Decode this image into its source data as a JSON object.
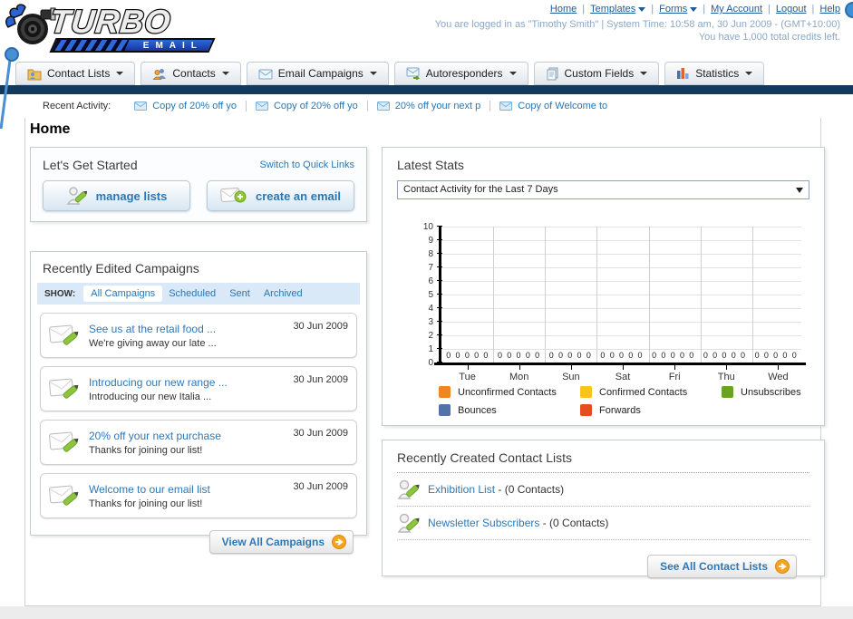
{
  "header": {
    "logo": {
      "title": "TURBO",
      "subtitle": "EMAIL"
    },
    "nav_links": [
      {
        "label": "Home",
        "has_dropdown": false
      },
      {
        "label": "Templates",
        "has_dropdown": true
      },
      {
        "label": "Forms",
        "has_dropdown": true
      },
      {
        "label": "My Account",
        "has_dropdown": false
      },
      {
        "label": "Logout",
        "has_dropdown": false
      },
      {
        "label": "Help",
        "has_dropdown": false
      }
    ],
    "login_info": "You are logged in as \"Timothy Smith\" | System Time: 10:58 am, 30 Jun 2009 - (GMT+10:00)",
    "credits_info": "You have 1,000 total credits left."
  },
  "nav_tabs": [
    {
      "label": "Contact Lists",
      "icon": "folder-contacts-icon"
    },
    {
      "label": "Contacts",
      "icon": "people-icon"
    },
    {
      "label": "Email Campaigns",
      "icon": "envelope-icon"
    },
    {
      "label": "Autoresponders",
      "icon": "envelope-arrow-icon"
    },
    {
      "label": "Custom Fields",
      "icon": "pages-icon"
    },
    {
      "label": "Statistics",
      "icon": "bar-chart-icon"
    }
  ],
  "recent_activity": {
    "label": "Recent Activity:",
    "items": [
      "Copy of 20% off yo",
      "Copy of 20% off yo",
      "20% off your next p",
      "Copy of Welcome to"
    ]
  },
  "page": {
    "title": "Home"
  },
  "get_started": {
    "title": "Let's Get Started",
    "switch_link": "Switch to Quick Links",
    "buttons": [
      {
        "label": "manage lists",
        "icon": "person-pencil-icon"
      },
      {
        "label": "create an email",
        "icon": "envelope-plus-icon"
      }
    ]
  },
  "campaigns": {
    "title": "Recently Edited Campaigns",
    "show_label": "SHOW:",
    "filters": [
      "All Campaigns",
      "Scheduled",
      "Sent",
      "Archived"
    ],
    "active_filter": "All Campaigns",
    "items": [
      {
        "title": "See us at the retail food ...",
        "subtitle": "We're giving away our late ...",
        "date": "30 Jun 2009"
      },
      {
        "title": "Introducing our new range ...",
        "subtitle": "Introducing our new Italia ...",
        "date": "30 Jun 2009"
      },
      {
        "title": "20% off your next purchase",
        "subtitle": "Thanks for joining our list!",
        "date": "30 Jun 2009"
      },
      {
        "title": "Welcome to our email list",
        "subtitle": "Thanks for joining our list!",
        "date": "30 Jun 2009"
      }
    ],
    "view_all_label": "View All Campaigns"
  },
  "stats": {
    "title": "Latest Stats",
    "dropdown_value": "Contact Activity for the Last 7 Days"
  },
  "chart_data": {
    "type": "bar",
    "title": "Contact Activity for the Last 7 Days",
    "categories": [
      "Tue",
      "Mon",
      "Sun",
      "Sat",
      "Fri",
      "Thu",
      "Wed"
    ],
    "series": [
      {
        "name": "Unconfirmed Contacts",
        "color": "#f08522",
        "values": [
          0,
          0,
          0,
          0,
          0,
          0,
          0
        ]
      },
      {
        "name": "Confirmed Contacts",
        "color": "#fbc31b",
        "values": [
          0,
          0,
          0,
          0,
          0,
          0,
          0
        ]
      },
      {
        "name": "Unsubscribes",
        "color": "#69a420",
        "values": [
          0,
          0,
          0,
          0,
          0,
          0,
          0
        ]
      },
      {
        "name": "Bounces",
        "color": "#5273a7",
        "values": [
          0,
          0,
          0,
          0,
          0,
          0,
          0
        ]
      },
      {
        "name": "Forwards",
        "color": "#e54d21",
        "values": [
          0,
          0,
          0,
          0,
          0,
          0,
          0
        ]
      }
    ],
    "xlabel": "",
    "ylabel": "",
    "ylim": [
      0,
      10
    ],
    "yticks": [
      0,
      1,
      2,
      3,
      4,
      5,
      6,
      7,
      8,
      9,
      10
    ],
    "grid": true,
    "legend_position": "bottom"
  },
  "contact_lists": {
    "title": "Recently Created Contact Lists",
    "items": [
      {
        "name": "Exhibition List",
        "suffix": " - (0 Contacts)"
      },
      {
        "name": "Newsletter Subscribers",
        "suffix": " - (0 Contacts)"
      }
    ],
    "see_all_label": "See All Contact Lists"
  }
}
